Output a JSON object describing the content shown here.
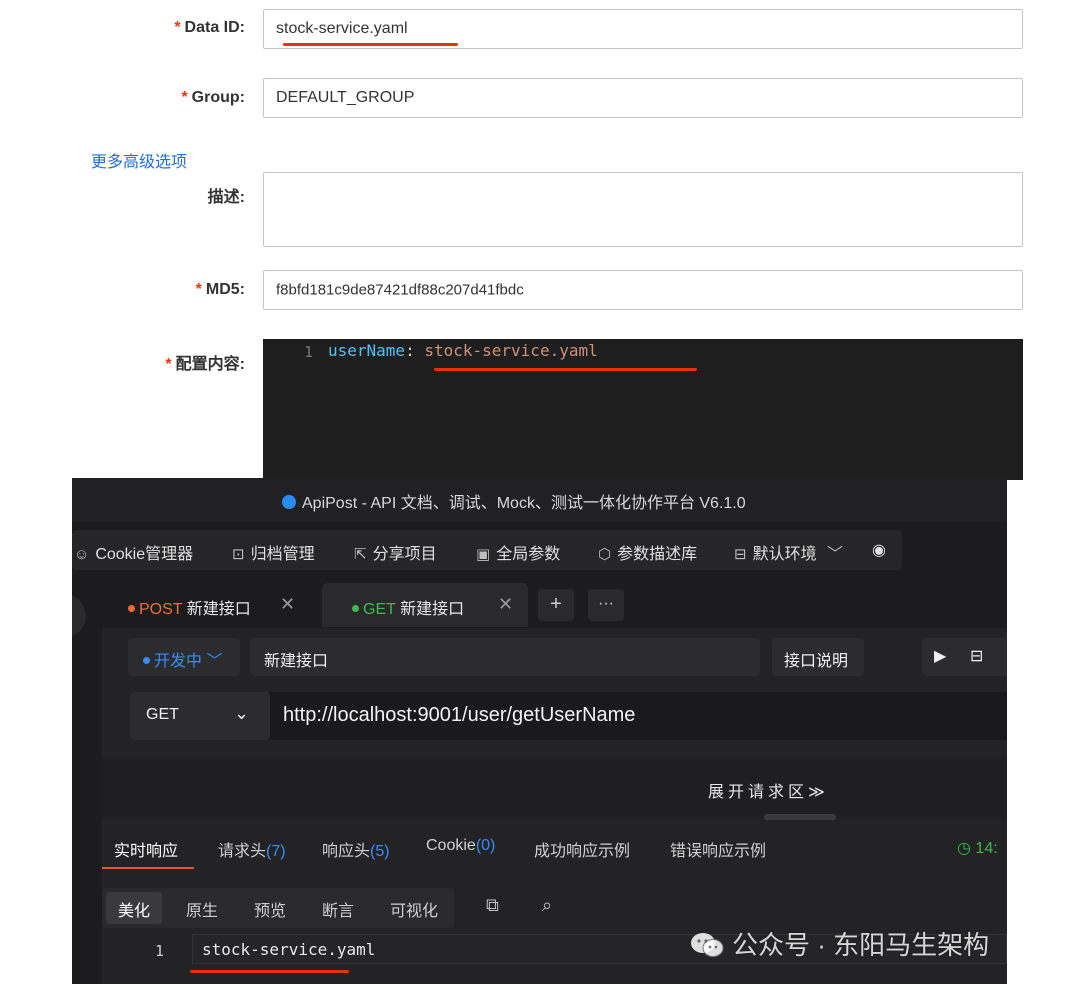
{
  "form": {
    "data_id": {
      "label": "Data ID:",
      "value": "stock-service.yaml",
      "required": "*"
    },
    "group": {
      "label": "Group:",
      "value": "DEFAULT_GROUP",
      "required": "*"
    },
    "more_options": "更多高级选项",
    "description": {
      "label": "描述:",
      "value": ""
    },
    "md5": {
      "label": "MD5:",
      "value": "f8bfd181c9de87421df88c207d41fbdc",
      "required": "*"
    },
    "content": {
      "label": "配置内容:",
      "required": "*",
      "line_number": "1",
      "key": "userName",
      "colon": ":",
      "value": "stock-service.yaml"
    }
  },
  "apipost": {
    "title": "ApiPost - API 文档、调试、Mock、测试一体化协作平台 V6.1.0",
    "toolbar": [
      {
        "label": "Cookie管理器",
        "icon": "cookie-icon"
      },
      {
        "label": "归档管理",
        "icon": "archive-icon"
      },
      {
        "label": "分享项目",
        "icon": "share-icon"
      },
      {
        "label": "全局参数",
        "icon": "global-params-icon"
      },
      {
        "label": "参数描述库",
        "icon": "cube-icon"
      },
      {
        "label": "默认环境",
        "icon": "environment-icon"
      }
    ],
    "tabs": [
      {
        "method": "POST",
        "name": "新建接口"
      },
      {
        "method": "GET",
        "name": "新建接口"
      }
    ],
    "status": "开发中",
    "api_name": "新建接口",
    "doc_button": "接口说明",
    "method": "GET",
    "url": "http://localhost:9001/user/getUserName",
    "expand_request": "展开请求区",
    "response_tabs": {
      "realtime": "实时响应",
      "req_headers": "请求头",
      "req_headers_count": "(7)",
      "resp_headers": "响应头",
      "resp_headers_count": "(5)",
      "cookie": "Cookie",
      "cookie_count": "(0)",
      "success_example": "成功响应示例",
      "error_example": "错误响应示例",
      "time": "14:"
    },
    "view_tabs": [
      "美化",
      "原生",
      "预览",
      "断言",
      "可视化"
    ],
    "response_line_number": "1",
    "response_body": "stock-service.yaml"
  },
  "watermark": "公众号 · 东阳马生架构",
  "colors": {
    "required": "#e8380d",
    "link": "#1f6fd6",
    "underline_red": "#e8310f",
    "post": "#f06a3a",
    "get": "#3fb950",
    "accent_blue": "#3b8bf5"
  }
}
